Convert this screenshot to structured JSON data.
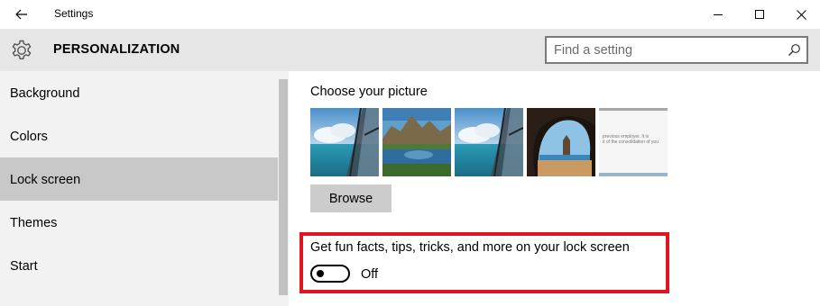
{
  "window": {
    "title": "Settings",
    "controls": [
      "minimize",
      "maximize",
      "close"
    ]
  },
  "header": {
    "heading": "PERSONALIZATION",
    "search_placeholder": "Find a setting",
    "icon": "gear-icon"
  },
  "sidebar": {
    "items": [
      {
        "label": "Background",
        "selected": false
      },
      {
        "label": "Colors",
        "selected": false
      },
      {
        "label": "Lock screen",
        "selected": true
      },
      {
        "label": "Themes",
        "selected": false
      },
      {
        "label": "Start",
        "selected": false
      }
    ]
  },
  "main": {
    "picture_section_title": "Choose your picture",
    "pictures": [
      {
        "name": "beach-with-window"
      },
      {
        "name": "mountain-lake"
      },
      {
        "name": "beach-with-window"
      },
      {
        "name": "sea-cave-arch"
      },
      {
        "name": "document-snippet",
        "snippet_lines": [
          "previous employer. It is",
          "it of the consolidation of you"
        ]
      }
    ],
    "browse_label": "Browse",
    "tips_label": "Get fun facts, tips, tricks, and more on your lock screen",
    "tips_toggle_state": "Off",
    "tips_toggle_on": false
  },
  "colors": {
    "highlight_border": "#e0161f",
    "selected_nav": "#c8c8c8",
    "header_bg": "#e6e6e6",
    "sidebar_bg": "#f2f2f2"
  }
}
